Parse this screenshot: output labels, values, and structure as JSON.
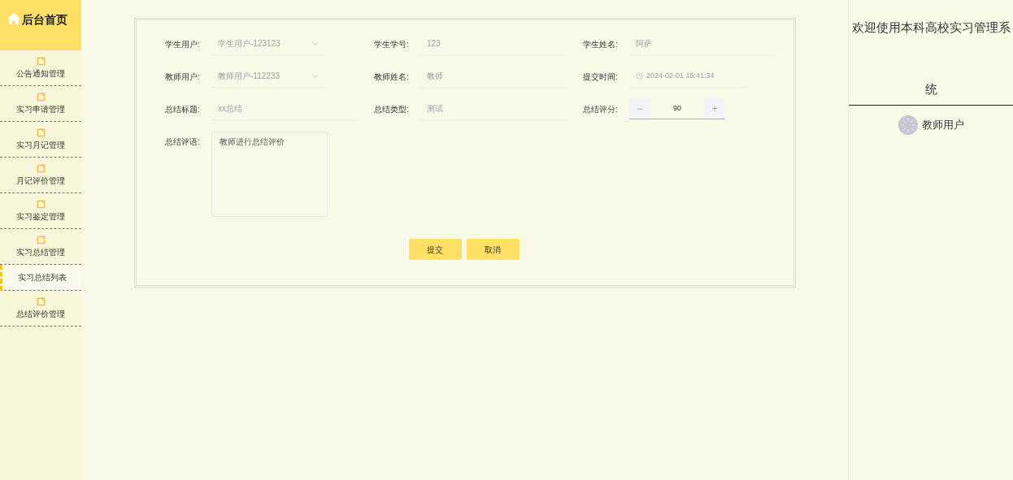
{
  "sidebar": {
    "home": "后台首页",
    "items": [
      {
        "label": "公告通知管理"
      },
      {
        "label": "实习申请管理"
      },
      {
        "label": "实习月记管理"
      },
      {
        "label": "月记评价管理"
      },
      {
        "label": "实习鉴定管理"
      },
      {
        "label": "实习总结管理",
        "children": [
          {
            "label": "实习总结列表",
            "selected": true
          }
        ]
      },
      {
        "label": "总结评价管理"
      }
    ]
  },
  "form": {
    "fields": [
      {
        "label": "学生用户:",
        "kind": "select",
        "value": "学生用户-123123",
        "disabled": true
      },
      {
        "label": "学生学号:",
        "kind": "text",
        "value": "123",
        "disabled": true
      },
      {
        "label": "学生姓名:",
        "kind": "text",
        "value": "阿萨",
        "disabled": true
      },
      {
        "label": "教师用户:",
        "kind": "select",
        "value": "教师用户-112233",
        "disabled": true
      },
      {
        "label": "教师姓名:",
        "kind": "text",
        "value": "教师",
        "disabled": true
      },
      {
        "label": "提交时间:",
        "kind": "datetime",
        "value": "2024-02-01 15:41:34",
        "disabled": true
      },
      {
        "label": "总结标题:",
        "kind": "text",
        "value": "xx总结",
        "disabled": true
      },
      {
        "label": "总结类型:",
        "kind": "text",
        "value": "测试",
        "disabled": true
      },
      {
        "label": "总结评分:",
        "kind": "number",
        "value": "90",
        "minus": "−",
        "plus": "+",
        "disabled": false
      },
      {
        "label": "总结评语:",
        "kind": "textarea",
        "value": "教师进行总结评价",
        "disabled": false
      }
    ],
    "buttons": [
      "提交",
      "取消"
    ]
  },
  "header": {
    "title": "欢迎使用本科高校实习管理系统",
    "user": "教师用户"
  }
}
